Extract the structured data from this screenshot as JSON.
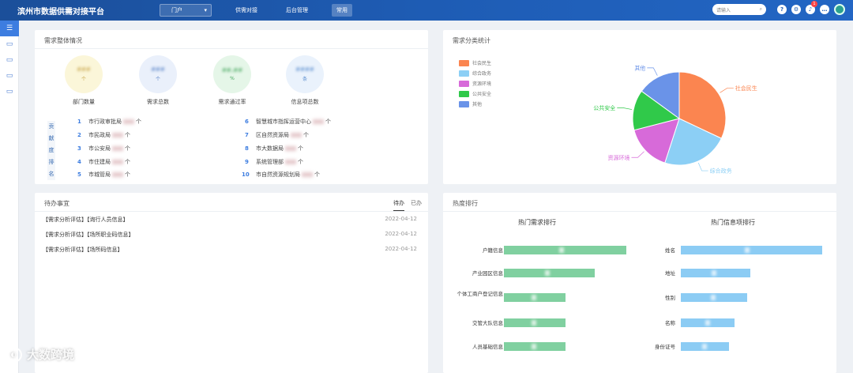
{
  "header": {
    "title": "滨州市数据供需对接平台",
    "portal_select": "门户",
    "nav": [
      "供需对接",
      "后台管理",
      "常用"
    ],
    "search_placeholder": "请输入"
  },
  "colors": {
    "accent": "#2366c4",
    "green": "#80d0a0",
    "blue": "#8cccf4"
  },
  "overview": {
    "title": "需求整体情况",
    "kpis": [
      {
        "value": "###",
        "unit": "个",
        "label": "部门数量"
      },
      {
        "value": "###",
        "unit": "个",
        "label": "需求总数"
      },
      {
        "value": "##.##",
        "unit": "%",
        "label": "需求通过率"
      },
      {
        "value": "####",
        "unit": "条",
        "label": "信息项总数"
      }
    ],
    "ranking_label": [
      "贡",
      "献",
      "度",
      "排",
      "名"
    ],
    "ranking": [
      {
        "no": "1",
        "name": "市行政审批局",
        "suffix": "个"
      },
      {
        "no": "2",
        "name": "市民政局",
        "suffix": "个"
      },
      {
        "no": "3",
        "name": "市公安局",
        "suffix": "个"
      },
      {
        "no": "4",
        "name": "市住建局",
        "suffix": "个"
      },
      {
        "no": "5",
        "name": "市城管局",
        "suffix": "个"
      },
      {
        "no": "6",
        "name": "智慧城市指挥运营中心",
        "suffix": "个"
      },
      {
        "no": "7",
        "name": "区自然资源局",
        "suffix": "个"
      },
      {
        "no": "8",
        "name": "市大数据局",
        "suffix": "个"
      },
      {
        "no": "9",
        "name": "系统管理部",
        "suffix": "个"
      },
      {
        "no": "10",
        "name": "市自然资源规划局",
        "suffix": "个"
      }
    ]
  },
  "category": {
    "title": "需求分类统计",
    "legend": [
      "社会民生",
      "综合政务",
      "资源环境",
      "公共安全",
      "其他"
    ],
    "chart_data": {
      "type": "pie",
      "categories": [
        "社会民生",
        "综合政务",
        "资源环境",
        "公共安全",
        "其他"
      ],
      "values": [
        32,
        23,
        16,
        14,
        15
      ],
      "colors": [
        "#fb8550",
        "#8ccff5",
        "#d76ad9",
        "#30c94a",
        "#6a93e8"
      ]
    }
  },
  "todo": {
    "title": "待办事宜",
    "tabs": [
      "待办",
      "已办"
    ],
    "items": [
      {
        "text": "【需求分析评估】【询行人员信息】",
        "date": "2022-04-12"
      },
      {
        "text": "【需求分析评估】【场所职业码信息】",
        "date": "2022-04-12"
      },
      {
        "text": "【需求分析评估】【场所码信息】",
        "date": "2022-04-12"
      }
    ]
  },
  "hot": {
    "title": "热度排行",
    "demand_title": "热门需求排行",
    "info_title": "热门信息项排行",
    "chart_data": [
      {
        "type": "bar",
        "title": "热门需求排行",
        "categories": [
          "户籍信息",
          "产业园区信息",
          "个体工商户登记信息",
          "交管大队信息",
          "人员基础信息"
        ],
        "values": [
          100,
          74,
          50,
          50,
          50
        ]
      },
      {
        "type": "bar",
        "title": "热门信息项排行",
        "categories": [
          "姓名",
          "地址",
          "性别",
          "名称",
          "身份证号"
        ],
        "values": [
          100,
          49,
          47,
          38,
          34
        ]
      }
    ]
  },
  "watermark": "大数跨境"
}
